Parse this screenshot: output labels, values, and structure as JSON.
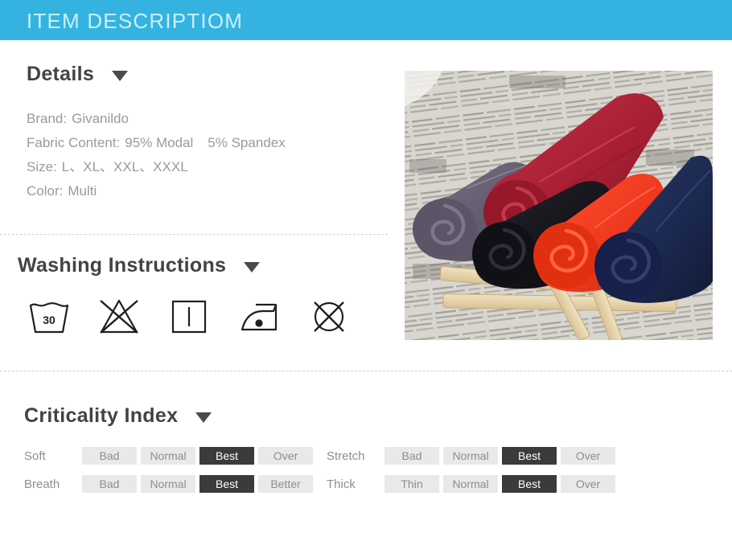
{
  "header": {
    "title": "ITEM DESCRIPTIOM"
  },
  "details": {
    "heading": "Details",
    "chevron": "chevron-down-icon",
    "rows": [
      {
        "key": "Brand:",
        "value": "Givanildo",
        "value2": ""
      },
      {
        "key": "Fabric Content:",
        "value": "95% Modal",
        "value2": "5%  Spandex"
      },
      {
        "key": "Size:",
        "value": "L、XL、XXL、XXXL",
        "value2": ""
      },
      {
        "key": "Color:",
        "value": "Multi",
        "value2": ""
      }
    ]
  },
  "product_image": {
    "alt": "five rolled garments on wooden slats over newspaper",
    "items": [
      {
        "name": "grey-purple-roll",
        "color": "#6a6374"
      },
      {
        "name": "crimson-roll",
        "color": "#b02232"
      },
      {
        "name": "black-roll",
        "color": "#17171c"
      },
      {
        "name": "orange-red-roll",
        "color": "#f03a22"
      },
      {
        "name": "navy-roll",
        "color": "#1d2a52"
      }
    ],
    "background": "#cdc9c2",
    "slat_color": "#e8d9b4"
  },
  "washing": {
    "heading": "Washing Instructions",
    "chevron": "chevron-down-icon",
    "icons": [
      {
        "name": "wash-30-icon",
        "label": "30"
      },
      {
        "name": "do-not-bleach-icon",
        "label": ""
      },
      {
        "name": "drip-dry-icon",
        "label": ""
      },
      {
        "name": "iron-low-icon",
        "label": ""
      },
      {
        "name": "do-not-dry-clean-icon",
        "label": ""
      }
    ]
  },
  "criticality": {
    "heading": "Criticality Index",
    "chevron": "chevron-down-icon",
    "rows": [
      {
        "left": {
          "label": "Soft",
          "cells": [
            "Bad",
            "Normal",
            "Best",
            "Over"
          ],
          "active": 2
        },
        "right": {
          "label": "Stretch",
          "cells": [
            "Bad",
            "Normal",
            "Best",
            "Over"
          ],
          "active": 2
        }
      },
      {
        "left": {
          "label": "Breath",
          "cells": [
            "Bad",
            "Normal",
            "Best",
            "Better"
          ],
          "active": 2
        },
        "right": {
          "label": "Thick",
          "cells": [
            "Thin",
            "Normal",
            "Best",
            "Over"
          ],
          "active": 2
        }
      }
    ]
  },
  "colors": {
    "header_bg": "#35b3e0",
    "header_text": "#c7f0fb",
    "heading_text": "#434343",
    "body_text": "#9a9a9a",
    "cell_bg": "#e9e9e9",
    "cell_active_bg": "#3b3b3b",
    "divider": "#cfcfcf"
  }
}
